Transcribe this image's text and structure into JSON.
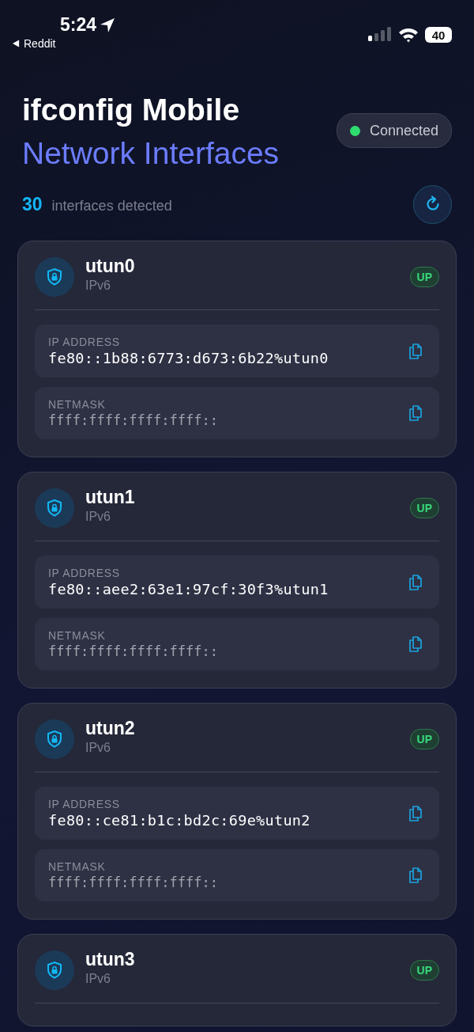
{
  "status_bar": {
    "time": "5:24",
    "back_label": "Reddit",
    "battery": "40"
  },
  "header": {
    "title": "ifconfig Mobile",
    "subtitle": "Network Interfaces",
    "connection": {
      "label": "Connected",
      "connected": true
    }
  },
  "summary": {
    "count": "30",
    "label": "interfaces detected"
  },
  "interfaces": [
    {
      "name": "utun0",
      "family": "IPv6",
      "status": "UP",
      "fields": [
        {
          "label": "IP ADDRESS",
          "value": "fe80::1b88:6773:d673:6b22%utun0",
          "kind": "primary"
        },
        {
          "label": "NETMASK",
          "value": "ffff:ffff:ffff:ffff::",
          "kind": "secondary"
        }
      ]
    },
    {
      "name": "utun1",
      "family": "IPv6",
      "status": "UP",
      "fields": [
        {
          "label": "IP ADDRESS",
          "value": "fe80::aee2:63e1:97cf:30f3%utun1",
          "kind": "primary"
        },
        {
          "label": "NETMASK",
          "value": "ffff:ffff:ffff:ffff::",
          "kind": "secondary"
        }
      ]
    },
    {
      "name": "utun2",
      "family": "IPv6",
      "status": "UP",
      "fields": [
        {
          "label": "IP ADDRESS",
          "value": "fe80::ce81:b1c:bd2c:69e%utun2",
          "kind": "primary"
        },
        {
          "label": "NETMASK",
          "value": "ffff:ffff:ffff:ffff::",
          "kind": "secondary"
        }
      ]
    },
    {
      "name": "utun3",
      "family": "IPv6",
      "status": "UP"
    }
  ]
}
